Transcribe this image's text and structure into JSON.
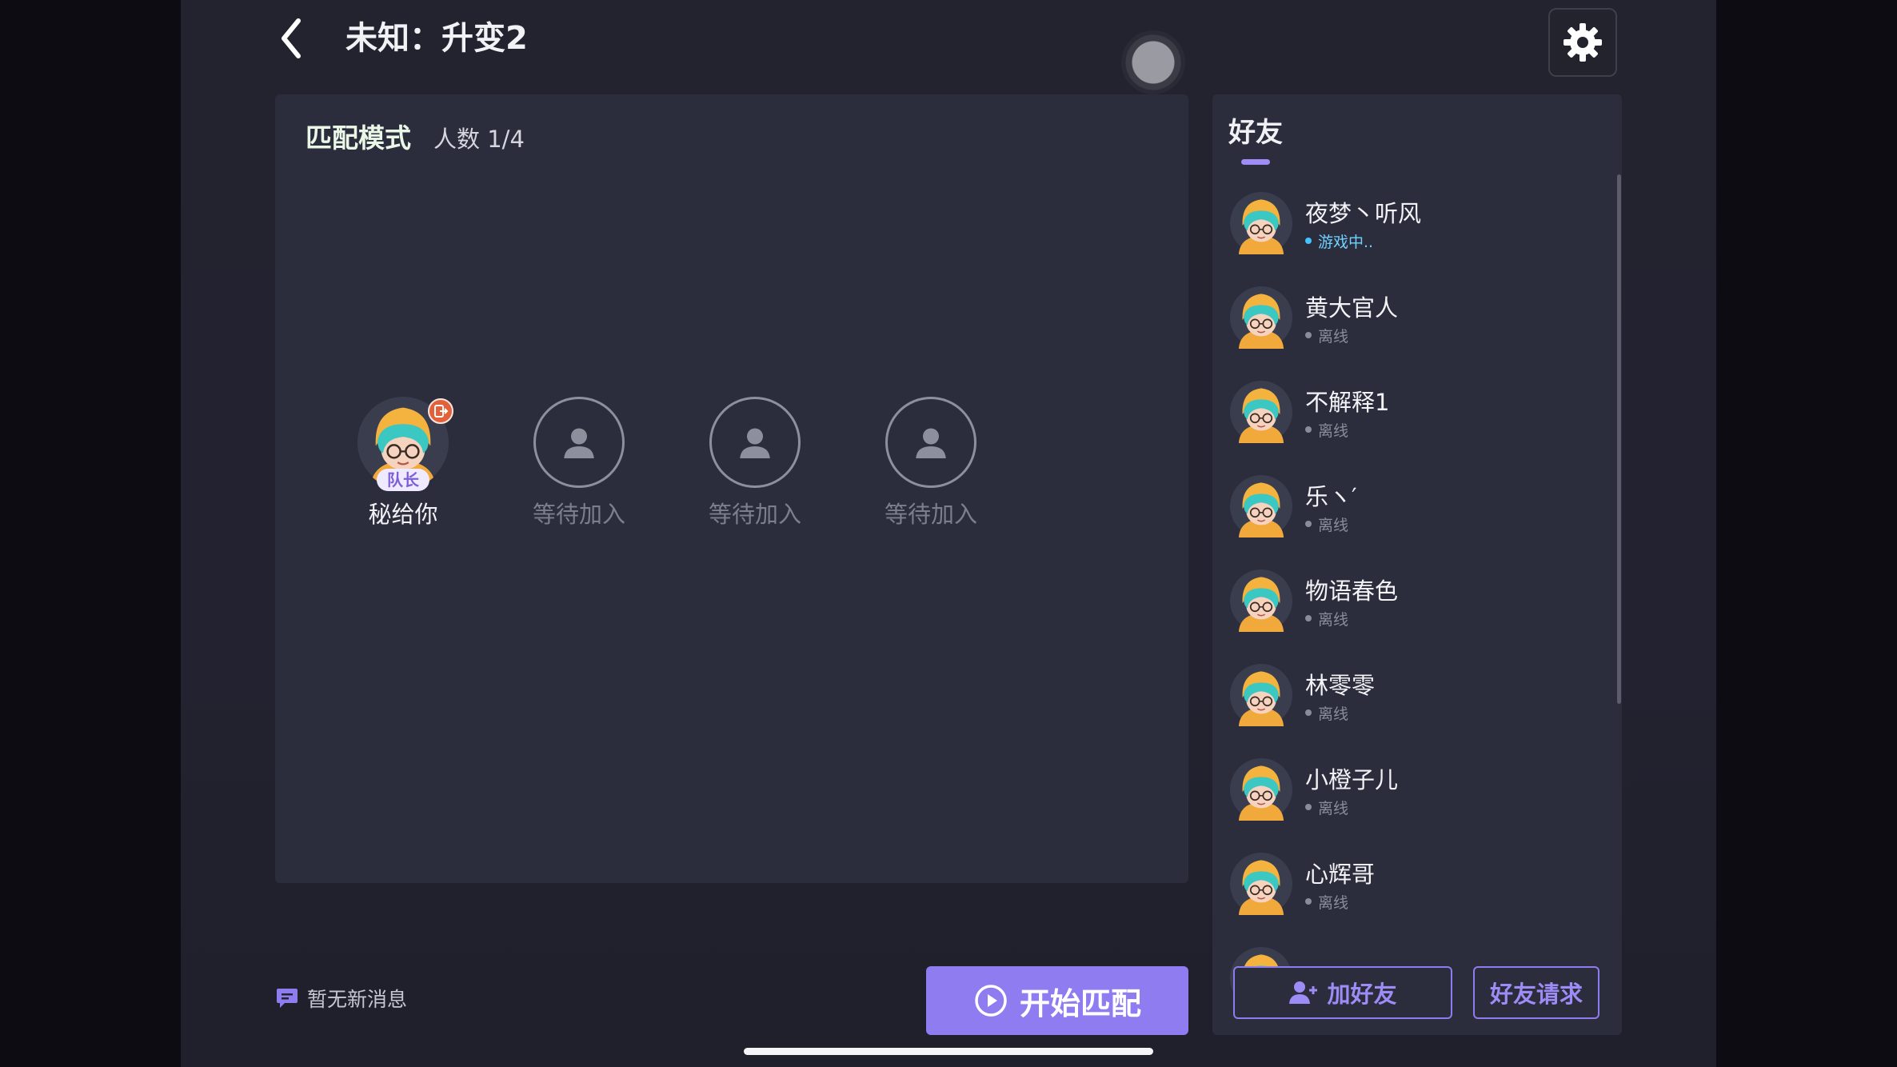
{
  "header": {
    "title": "未知：升变2",
    "back_icon": "chevron-left-icon",
    "settings_icon": "gear-icon"
  },
  "lobby": {
    "mode_label": "匹配模式",
    "player_count": "人数 1/4",
    "slots": [
      {
        "name": "秘给你",
        "badge": "队长",
        "is_me": true
      },
      {
        "name": "等待加入"
      },
      {
        "name": "等待加入"
      },
      {
        "name": "等待加入"
      }
    ]
  },
  "messages": {
    "text": "暂无新消息",
    "icon": "chat-bubble-icon"
  },
  "start_button": {
    "label": "开始匹配",
    "icon": "play-circle-icon"
  },
  "friends": {
    "title": "好友",
    "items": [
      {
        "name": "夜梦丶听风",
        "status": "游戏中..",
        "online": true
      },
      {
        "name": "黄大官人",
        "status": "离线",
        "online": false
      },
      {
        "name": "不解释1",
        "status": "离线",
        "online": false
      },
      {
        "name": "乐ヽ′",
        "status": "离线",
        "online": false
      },
      {
        "name": "物语春色",
        "status": "离线",
        "online": false
      },
      {
        "name": "林零零",
        "status": "离线",
        "online": false
      },
      {
        "name": "小橙子儿",
        "status": "离线",
        "online": false
      },
      {
        "name": "心辉哥",
        "status": "离线",
        "online": false
      }
    ],
    "add_button": "加好友",
    "requests_button": "好友请求"
  },
  "colors": {
    "accent": "#8e7cf0",
    "panel": "#2b2d3c",
    "background": "#23232f",
    "online": "#42c4ff",
    "exit_badge": "#e2603a"
  }
}
